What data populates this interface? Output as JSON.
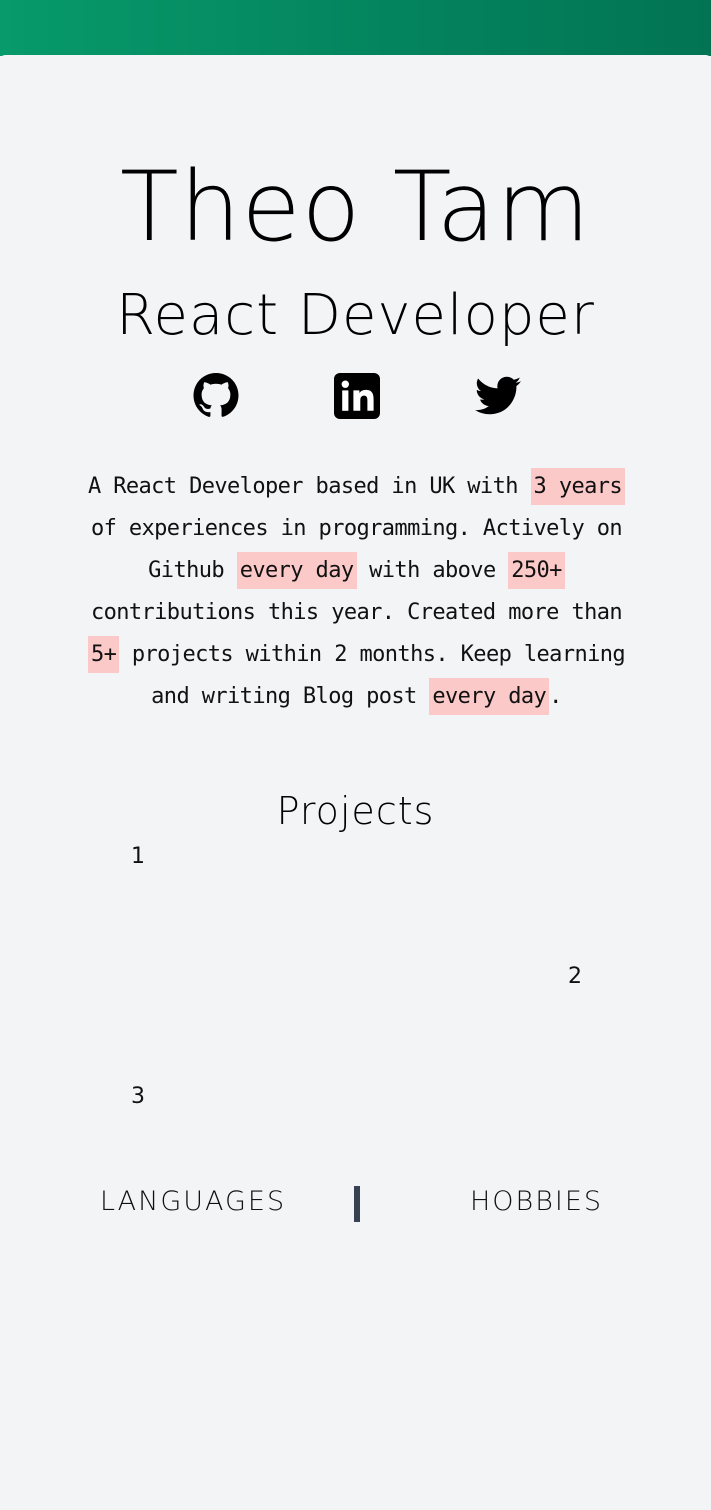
{
  "profile": {
    "name": "Theo Tam",
    "role": "React Developer"
  },
  "social": [
    {
      "name": "github",
      "icon": "github-icon"
    },
    {
      "name": "linkedin",
      "icon": "linkedin-icon"
    },
    {
      "name": "twitter",
      "icon": "twitter-icon"
    }
  ],
  "bio": {
    "t1": "A React Developer based in UK with ",
    "h1": "3 years",
    "t2": " of experiences in programming. Actively on Github ",
    "h2": "every day",
    "t3": " with above ",
    "h3": "250+",
    "t4": " contributions this year. Created more than ",
    "h4": "5+",
    "t5": " projects within 2 months. Keep learning and writing Blog post ",
    "h5": "every day",
    "t6": "."
  },
  "projects": {
    "title": "Projects",
    "items": [
      "1",
      "2",
      "3"
    ]
  },
  "tabs": {
    "languages": "LANGUAGES",
    "hobbies": "HOBBIES"
  },
  "colors": {
    "header_gradient_start": "#079a6a",
    "header_gradient_end": "#027453",
    "background": "#f3f4f6",
    "highlight": "#fcc9c9",
    "divider": "#374151"
  }
}
